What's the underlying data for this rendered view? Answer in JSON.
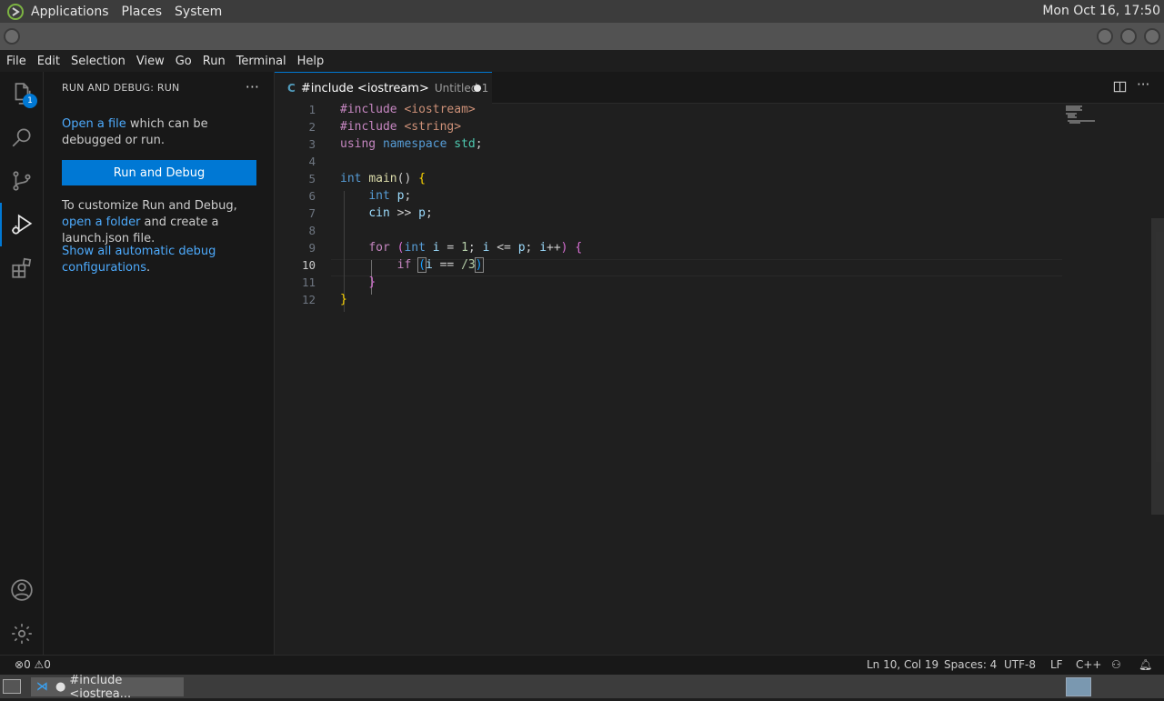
{
  "system_panel": {
    "menus": [
      "Applications",
      "Places",
      "System"
    ],
    "clock": "Mon Oct 16, 17:50"
  },
  "menu_bar": [
    "File",
    "Edit",
    "Selection",
    "View",
    "Go",
    "Run",
    "Terminal",
    "Help"
  ],
  "activity_bar": {
    "explorer_badge": "1",
    "items": [
      "files-icon",
      "search-icon",
      "source-control-icon",
      "run-debug-icon",
      "extensions-icon",
      "account-icon",
      "settings-gear-icon"
    ]
  },
  "sidebar": {
    "title": "RUN AND DEBUG: RUN",
    "open_file_link": "Open a file",
    "open_file_text": " which can be debugged or run.",
    "run_button": "Run and Debug",
    "customize_text_1": "To customize Run and Debug, ",
    "open_folder_link": "open a folder",
    "customize_text_2": " and create a launch.json file.",
    "show_configs_link": "Show all automatic debug configurations",
    "show_configs_suffix": "."
  },
  "tab": {
    "icon": "C",
    "name": "#include <iostream>",
    "description": "Untitled-1"
  },
  "editor": {
    "line_numbers": [
      "1",
      "2",
      "3",
      "4",
      "5",
      "6",
      "7",
      "8",
      "9",
      "10",
      "11",
      "12"
    ],
    "current_line": 10
  },
  "status_bar": {
    "problems": "0",
    "warnings": "0",
    "position": "Ln 10, Col 19",
    "spaces": "Spaces: 4",
    "encoding": "UTF-8",
    "eol": "LF",
    "language": "C++"
  },
  "taskbar": {
    "window_title": "#include <iostrea..."
  }
}
